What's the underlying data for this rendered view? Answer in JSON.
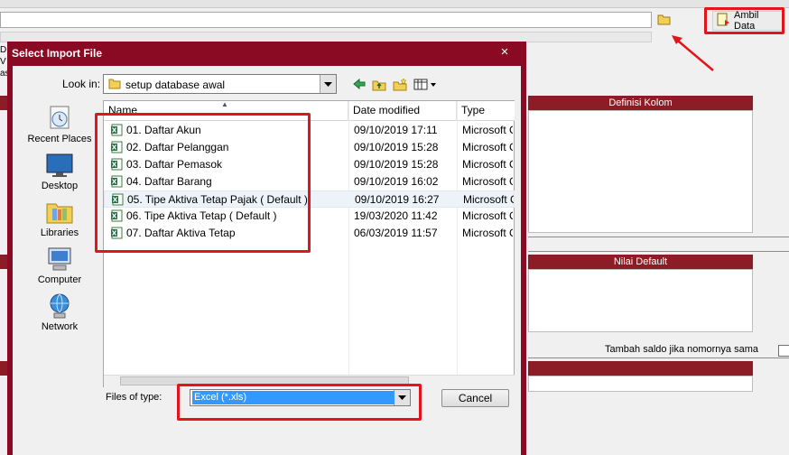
{
  "background": {
    "ambil_data_label": "Ambil Data",
    "left_fragments": [
      "D",
      "V",
      "as"
    ],
    "panel_definisi": "Definisi Kolom",
    "panel_nilai_default": "Nilai Default",
    "checkbox_label": "Tambah saldo jika nomornya sama"
  },
  "dialog": {
    "title": "Select Import File",
    "close_glyph": "×",
    "look_in_label": "Look in:",
    "look_in_value": "setup database awal",
    "places": [
      "Recent Places",
      "Desktop",
      "Libraries",
      "Computer",
      "Network"
    ],
    "columns": [
      "Name",
      "Date modified",
      "Type"
    ],
    "files": [
      {
        "name": "01. Daftar Akun",
        "date": "09/10/2019 17:11",
        "type": "Microsoft C"
      },
      {
        "name": "02. Daftar Pelanggan",
        "date": "09/10/2019 15:28",
        "type": "Microsoft C"
      },
      {
        "name": "03. Daftar Pemasok",
        "date": "09/10/2019 15:28",
        "type": "Microsoft C"
      },
      {
        "name": "04. Daftar Barang",
        "date": "09/10/2019 16:02",
        "type": "Microsoft C"
      },
      {
        "name": "05. Tipe Aktiva Tetap Pajak ( Default )",
        "date": "09/10/2019 16:27",
        "type": "Microsoft C"
      },
      {
        "name": "06. Tipe Aktiva Tetap ( Default )",
        "date": "19/03/2020 11:42",
        "type": "Microsoft C"
      },
      {
        "name": "07. Daftar Aktiva Tetap",
        "date": "06/03/2019 11:57",
        "type": "Microsoft C"
      }
    ],
    "files_of_type_label": "Files of type:",
    "files_of_type_value": "Excel (*.xls)",
    "cancel_label": "Cancel"
  },
  "colors": {
    "dialog_frame": "#8b0a23",
    "panel_header": "#8c1d27",
    "selection": "#3399ff",
    "annotation": "#e3141b"
  }
}
